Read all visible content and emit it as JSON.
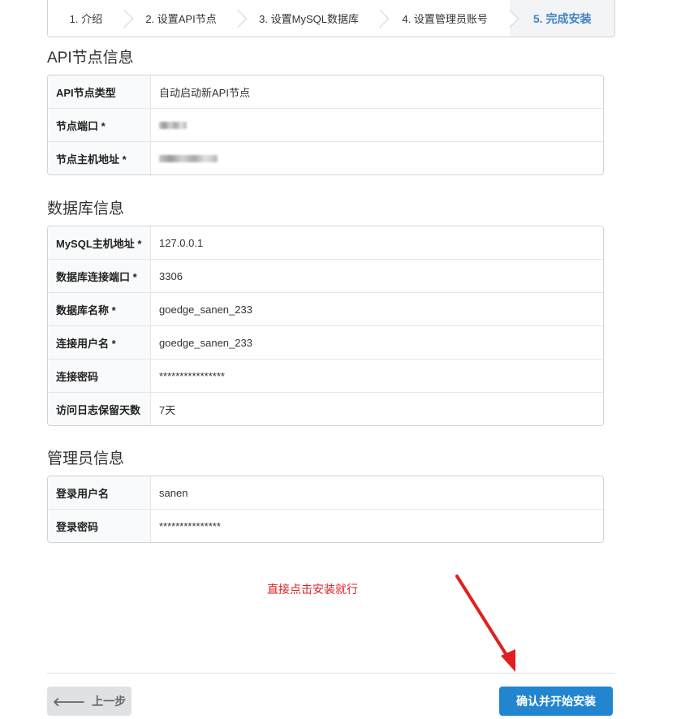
{
  "steps": [
    {
      "label": "1. 介绍"
    },
    {
      "label": "2. 设置API节点"
    },
    {
      "label": "3. 设置MySQL数据库"
    },
    {
      "label": "4. 设置管理员账号"
    },
    {
      "label": "5. 完成安装",
      "active": true
    }
  ],
  "api_section": {
    "title": "API节点信息",
    "rows": [
      {
        "label": "API节点类型",
        "value": "自动启动新API节点"
      },
      {
        "label": "节点端口 *",
        "value": ""
      },
      {
        "label": "节点主机地址 *",
        "value": ""
      }
    ]
  },
  "db_section": {
    "title": "数据库信息",
    "rows": [
      {
        "label": "MySQL主机地址 *",
        "value": "127.0.0.1"
      },
      {
        "label": "数据库连接端口 *",
        "value": "3306"
      },
      {
        "label": "数据库名称 *",
        "value": "goedge_sanen_233"
      },
      {
        "label": "连接用户名 *",
        "value": "goedge_sanen_233"
      },
      {
        "label": "连接密码",
        "value": "****************"
      },
      {
        "label": "访问日志保留天数",
        "value": "7天"
      }
    ]
  },
  "admin_section": {
    "title": "管理员信息",
    "rows": [
      {
        "label": "登录用户名",
        "value": "sanen"
      },
      {
        "label": "登录密码",
        "value": "***************"
      }
    ]
  },
  "note": "直接点击安装就行",
  "buttons": {
    "prev_label": "上一步",
    "confirm_label": "确认并开始安装"
  },
  "colors": {
    "note": "#e02020",
    "arrow": "#e02020",
    "primary": "#2185d0",
    "active_step": "#4183c4"
  }
}
